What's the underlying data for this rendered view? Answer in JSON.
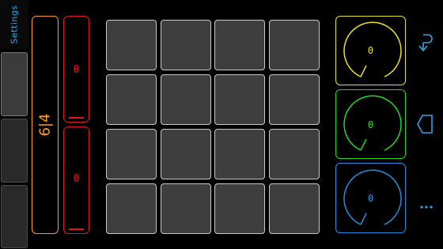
{
  "sidebar": {
    "settings_label": "Settings"
  },
  "strips": {
    "time_signature": "6|4",
    "red_top_value": "0",
    "red_bottom_value": "0"
  },
  "pads": {
    "count": 16
  },
  "knobs": [
    {
      "value": "0",
      "color": "#e8e21a"
    },
    {
      "value": "0",
      "color": "#22d81e"
    },
    {
      "value": "0",
      "color": "#1e8fe0"
    }
  ],
  "nav": {
    "icons": [
      "undo-icon",
      "back-icon",
      "more-icon"
    ]
  },
  "colors": {
    "orange": "#ff9d1a",
    "red": "#e0161c",
    "accent_blue": "#2ea4e6",
    "pad_fill": "#3e3e3e"
  }
}
